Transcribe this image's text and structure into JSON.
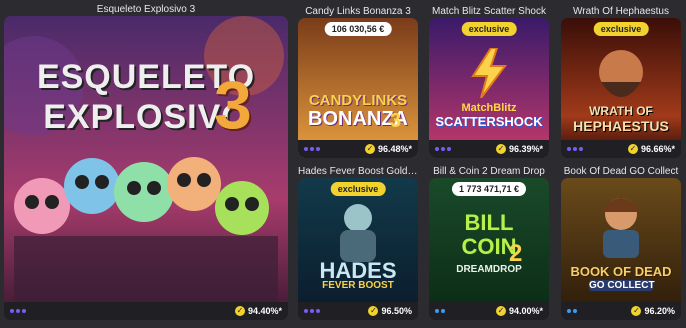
{
  "games": [
    {
      "title": "Esqueleto Explosivo 3",
      "logo": [
        "ESQUELETO",
        "EXPLOSIVO"
      ],
      "logo_num": "3",
      "rtp": "94.40%*",
      "dots": [
        "#7b5cf0",
        "#7b5cf0",
        "#7b5cf0"
      ]
    },
    {
      "title": "Candy Links Bonanza 3",
      "badge": "106 030,56 €",
      "logo": [
        "CANDYLINKS",
        "BONANZA"
      ],
      "logo_num": "3",
      "rtp": "96.48%*",
      "dots": [
        "#7b5cf0",
        "#7b5cf0",
        "#7b5cf0"
      ]
    },
    {
      "title": "Match Blitz Scatter Shock",
      "badge": "exclusive",
      "logo": [
        "MatchBlitz",
        "SCATTERSHOCK"
      ],
      "rtp": "96.39%*",
      "dots": [
        "#7b5cf0",
        "#7b5cf0",
        "#7b5cf0"
      ]
    },
    {
      "title": "Wrath Of Hephaestus",
      "badge": "exclusive",
      "logo": [
        "WRATH OF",
        "HEPHAESTUS"
      ],
      "rtp": "96.66%*",
      "dots": [
        "#7b5cf0",
        "#7b5cf0",
        "#7b5cf0"
      ]
    },
    {
      "title": "Hades Fever Boost Gold Blitz F...",
      "badge": "exclusive",
      "logo": [
        "HADES",
        "FEVER BOOST"
      ],
      "rtp": "96.50%",
      "dots": [
        "#7b5cf0",
        "#7b5cf0",
        "#7b5cf0"
      ]
    },
    {
      "title": "Bill & Coin 2 Dream Drop",
      "badge": "1 773 471,71 €",
      "logo": [
        "BILL",
        "COIN"
      ],
      "logo_num": "2",
      "logo_sub": "DREAMDROP",
      "rtp": "94.00%*",
      "dots": [
        "#3b9cf0",
        "#3b9cf0"
      ]
    },
    {
      "title": "Book Of Dead GO Collect",
      "logo": [
        "BOOK OF DEAD",
        "GO COLLECT"
      ],
      "rtp": "96.20%",
      "dots": [
        "#3b9cf0",
        "#3b9cf0"
      ]
    }
  ]
}
